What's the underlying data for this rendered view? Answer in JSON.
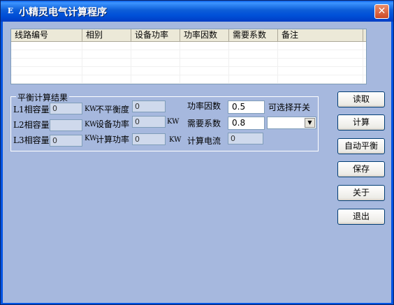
{
  "window": {
    "icon_glyph": "E",
    "title": "小精灵电气计算程序",
    "close_glyph": "✕"
  },
  "table": {
    "columns": [
      "线路编号",
      "相别",
      "设备功率",
      "功率因数",
      "需要系数",
      "备注"
    ]
  },
  "group": {
    "title": "平衡计算结果",
    "l1_label": "L1相容量",
    "l1_value": "0",
    "l2_label": "L2相容量",
    "l2_value": "",
    "l3_label": "L3相容量",
    "l3_value": "0",
    "unit_kw_upper": "KW",
    "unbalance_label": "不平衡度",
    "unbalance_value": "0",
    "device_power_label": "设备功率",
    "device_power_value": "0",
    "calc_power_label": "计算功率",
    "calc_power_value": "0",
    "pf_label": "功率因数",
    "pf_value": "0.5",
    "demand_label": "需要系数",
    "demand_value": "0.8",
    "calc_current_label": "计算电流",
    "calc_current_value": "0",
    "optional_switch_label": "可选择开关",
    "switch_select_value": ""
  },
  "buttons": {
    "read": "读取",
    "calc": "计算",
    "auto_balance": "自动平衡",
    "save": "保存",
    "about": "关于",
    "exit": "退出"
  }
}
